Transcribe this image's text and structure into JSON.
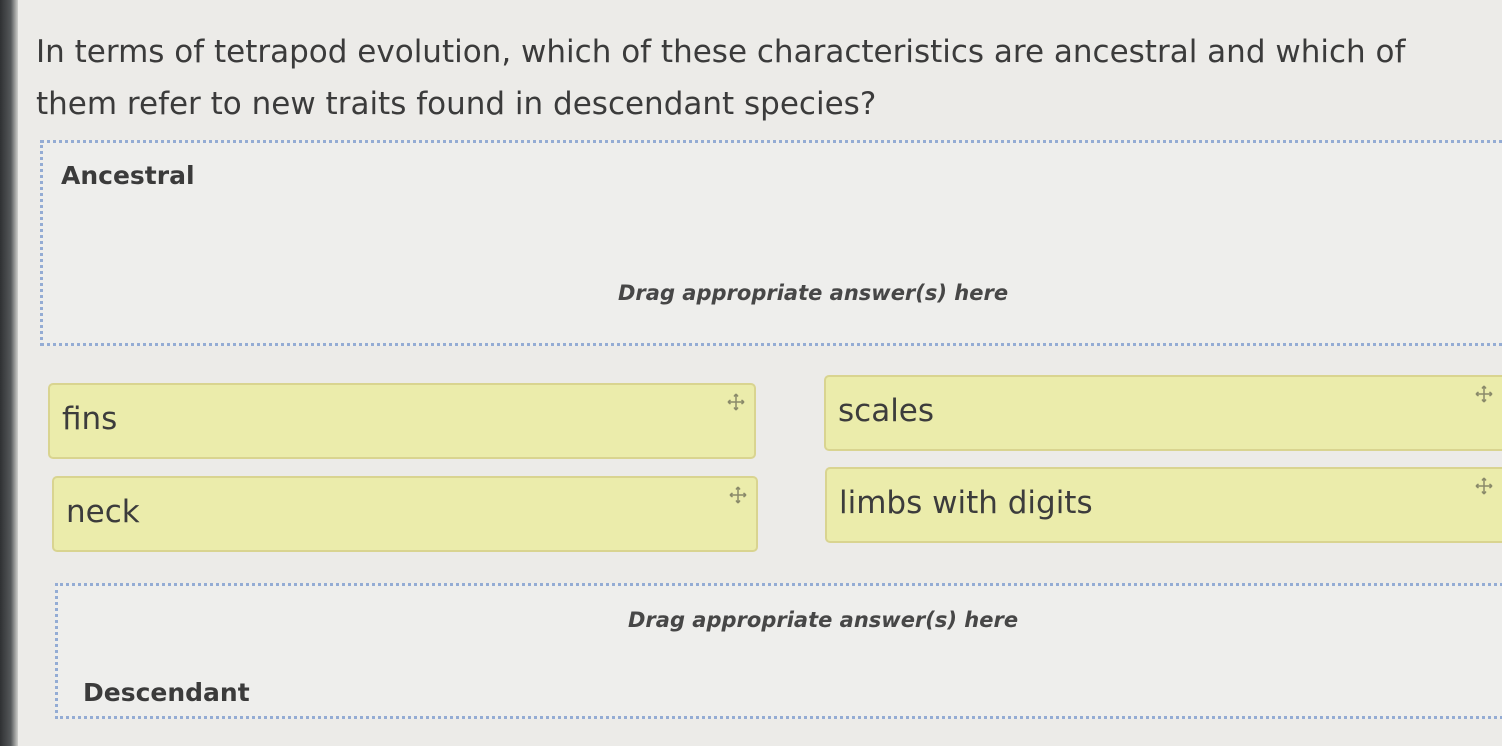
{
  "question": {
    "text": "In terms of tetrapod evolution, which of these characteristics are ancestral and which of them refer to new traits found in descendant species?"
  },
  "zones": {
    "ancestral": {
      "label": "Ancestral",
      "hint": "Drag appropriate answer(s) here"
    },
    "descendant": {
      "label": "Descendant",
      "hint": "Drag appropriate answer(s) here"
    }
  },
  "answers": [
    {
      "label": "fins",
      "icon": "move-icon"
    },
    {
      "label": "scales",
      "icon": "move-icon"
    },
    {
      "label": "neck",
      "icon": "move-icon"
    },
    {
      "label": "limbs with digits",
      "icon": "move-icon"
    }
  ],
  "colors": {
    "answer_bg": "#ebecab",
    "answer_border": "#d9d490",
    "dropzone_border": "#94acd4",
    "page_bg": "#ecebe8"
  }
}
